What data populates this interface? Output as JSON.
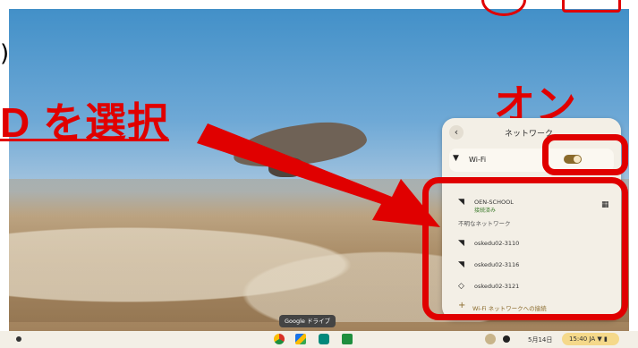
{
  "annotations": {
    "select_text": "D を選択",
    "on_text": "オン"
  },
  "network_panel": {
    "title": "ネットワーク",
    "back_icon": "chevron-left-icon",
    "wifi": {
      "label": "Wi-Fi",
      "toggle_on": true
    },
    "connected": {
      "name": "OEN-SCHOOL",
      "status": "接続済み"
    },
    "unknown_header": "不明なネットワーク",
    "networks": [
      "oskedu02-3110",
      "oskedu02-3116",
      "oskedu02-3121"
    ],
    "join_label": "Wi-Fi ネットワークへの接続"
  },
  "shelf": {
    "tooltip": "Google ドライブ",
    "date": "5月14日",
    "time": "15:40",
    "ime": "JA",
    "apps": [
      "chrome-icon",
      "drive-icon",
      "meet-icon",
      "classroom-icon"
    ]
  },
  "colors": {
    "annotation_red": "#e00000",
    "toggle_accent": "#8a6a2b",
    "panel_bg": "#f3efe6"
  }
}
